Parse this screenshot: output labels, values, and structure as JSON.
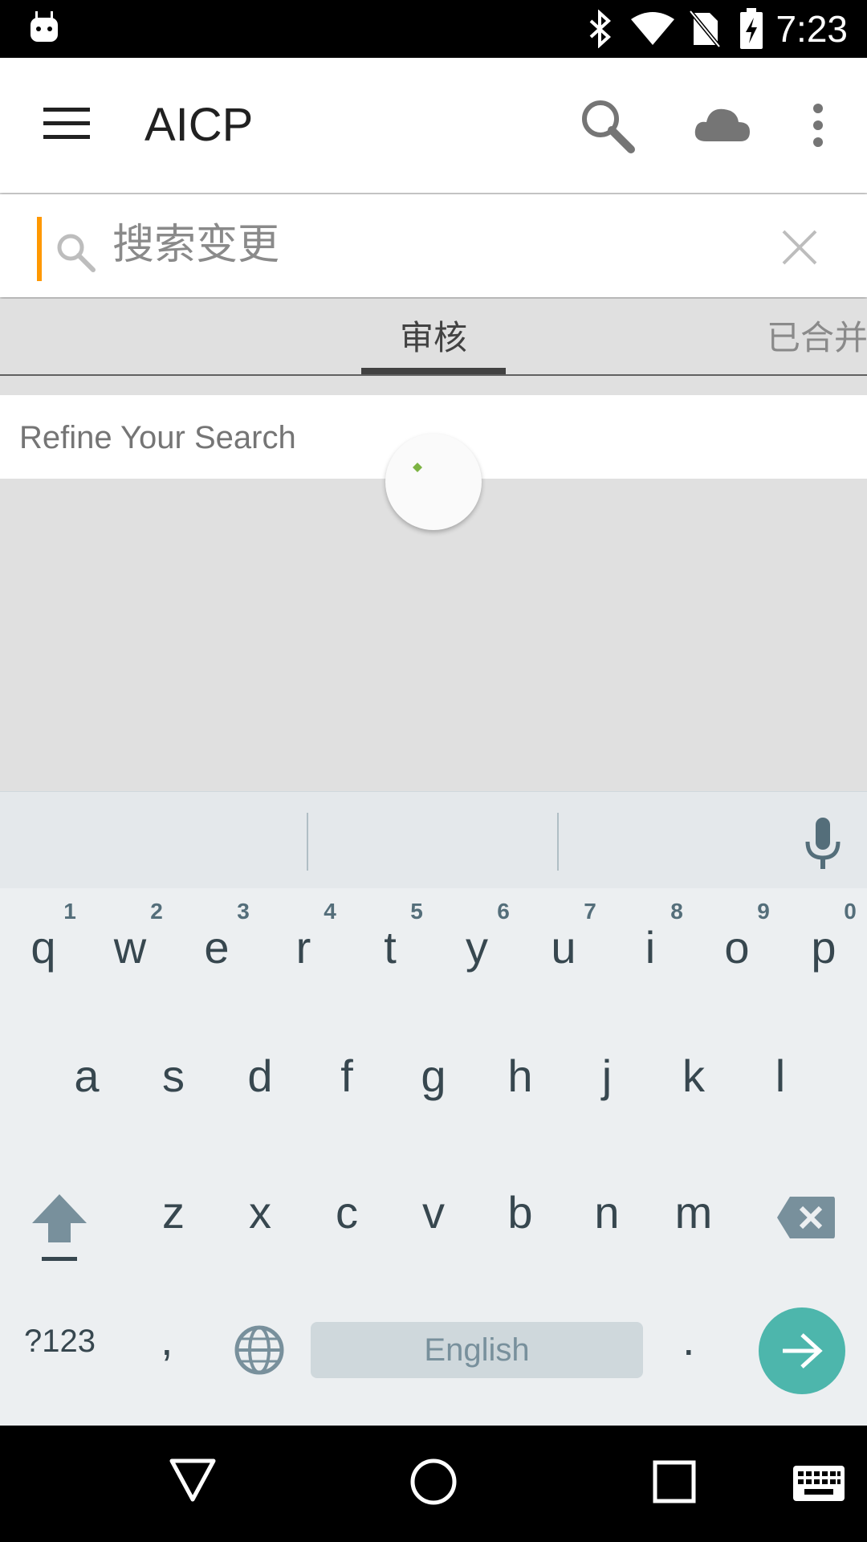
{
  "status_bar": {
    "time": "7:23"
  },
  "toolbar": {
    "title": "AICP",
    "icons": [
      "menu-icon",
      "search-icon",
      "cloud-icon",
      "more-vert-icon"
    ]
  },
  "search": {
    "placeholder": "搜索变更",
    "accent_color": "#ff9800"
  },
  "tabs": [
    {
      "label": "审核",
      "selected": true
    },
    {
      "label": "已合并",
      "selected": false
    }
  ],
  "content": {
    "refine_label": "Refine Your Search",
    "spinner_color": "#7cb342"
  },
  "keyboard": {
    "row1": [
      {
        "letter": "q",
        "num": "1"
      },
      {
        "letter": "w",
        "num": "2"
      },
      {
        "letter": "e",
        "num": "3"
      },
      {
        "letter": "r",
        "num": "4"
      },
      {
        "letter": "t",
        "num": "5"
      },
      {
        "letter": "y",
        "num": "6"
      },
      {
        "letter": "u",
        "num": "7"
      },
      {
        "letter": "i",
        "num": "8"
      },
      {
        "letter": "o",
        "num": "9"
      },
      {
        "letter": "p",
        "num": "0"
      }
    ],
    "row2": [
      "a",
      "s",
      "d",
      "f",
      "g",
      "h",
      "j",
      "k",
      "l"
    ],
    "row3": [
      "z",
      "x",
      "c",
      "v",
      "b",
      "n",
      "m"
    ],
    "symbols_label": "?123",
    "comma": ",",
    "period": ".",
    "space_label": "English",
    "enter_color": "#4db6ac"
  },
  "nav_bar": {
    "icons": [
      "back-icon",
      "home-icon",
      "recents-icon",
      "keyboard-icon"
    ]
  }
}
